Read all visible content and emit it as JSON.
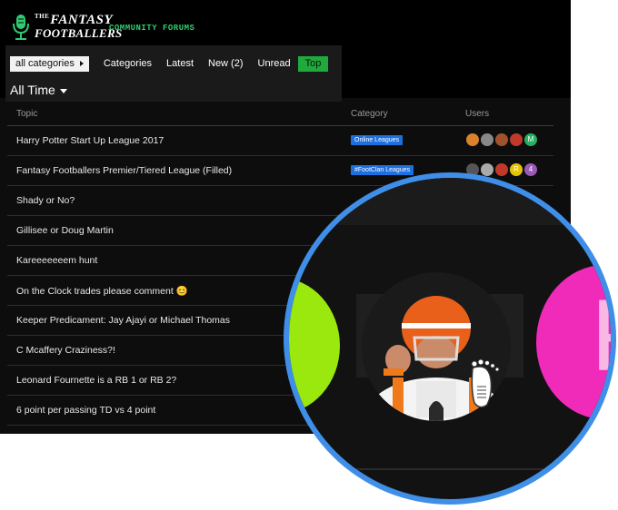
{
  "header": {
    "logo_the": "THE",
    "logo_line1": "FANTASY",
    "logo_line2": "FOOTBALLERS",
    "logo_subtitle": "COMMUNITY FORUMS"
  },
  "nav": {
    "category_dropdown": "all categories",
    "items": [
      "Categories",
      "Latest",
      "New (2)",
      "Unread",
      "Top"
    ],
    "active": "Top"
  },
  "period": {
    "label": "All Time"
  },
  "table": {
    "columns": {
      "topic": "Topic",
      "category": "Category",
      "users": "Users"
    },
    "rows": [
      {
        "title": "Harry Potter Start Up League 2017",
        "category": "Online Leagues",
        "users": [
          "#d9822b",
          "#888888",
          "#a0522d",
          "#c0392b",
          "#27ae60"
        ],
        "user_letters": [
          "",
          "",
          "",
          "",
          "M"
        ]
      },
      {
        "title": "Fantasy Footballers Premier/Tiered League (Filled)",
        "category": "#FootClan Leagues",
        "users": [
          "#555555",
          "#aaaaaa",
          "#c0392b",
          "#e6c200",
          "#9b59b6"
        ],
        "user_letters": [
          "",
          "",
          "",
          "R",
          "4"
        ]
      },
      {
        "title": "Shady or No?",
        "category": "",
        "users": [],
        "user_letters": []
      },
      {
        "title": "Gillisee or Doug Martin",
        "category": "",
        "users": [],
        "user_letters": []
      },
      {
        "title": "Kareeeeeeem hunt",
        "category": "",
        "users": [],
        "user_letters": []
      },
      {
        "title": "On the Clock trades please comment 😊",
        "category": "",
        "users": [],
        "user_letters": []
      },
      {
        "title": "Keeper Predicament: Jay Ajayi or Michael Thomas",
        "category": "",
        "users": [],
        "user_letters": []
      },
      {
        "title": "C Mcaffery Craziness?!",
        "category": "",
        "users": [],
        "user_letters": []
      },
      {
        "title": "Leonard Fournette is a RB 1 or RB 2?",
        "category": "",
        "users": [],
        "user_letters": []
      },
      {
        "title": "6 point per passing TD vs 4 point",
        "category": "",
        "users": [],
        "user_letters": []
      }
    ]
  },
  "zoom": {
    "pink_avatar_letter": "F",
    "colors": {
      "ring": "#3f8fe8",
      "green": "#9be80f",
      "pink": "#f02ab9"
    }
  },
  "colors": {
    "accent_green": "#1faa3c",
    "badge_blue": "#1e6fe0"
  }
}
